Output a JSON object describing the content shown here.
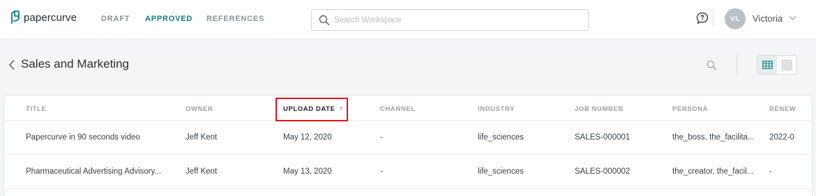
{
  "app": {
    "logo_text": "papercurve"
  },
  "nav": {
    "tabs": [
      {
        "label": "DRAFT"
      },
      {
        "label": "APPROVED"
      },
      {
        "label": "REFERENCES"
      }
    ]
  },
  "search": {
    "placeholder": "Search Workspace"
  },
  "user": {
    "initials": "VL",
    "name": "Victoria"
  },
  "page": {
    "title": "Sales and Marketing"
  },
  "colors": {
    "accent": "#127b7f",
    "highlight": "#e0121a"
  },
  "table": {
    "columns": [
      "TITLE",
      "OWNER",
      "UPLOAD DATE",
      "CHANNEL",
      "INDUSTRY",
      "JOB NUMBER",
      "PERSONA",
      "RENEW"
    ],
    "sort_indicator": "↑",
    "rows": [
      [
        "Papercurve in 90 seconds video",
        "Jeff Kent",
        "May 12, 2020",
        "-",
        "life_sciences",
        "SALES-000001",
        "the_boss, the_facilita...",
        "2022-0"
      ],
      [
        "Pharmaceutical Advertising Advisory...",
        "Jeff Kent",
        "May 13, 2020",
        "-",
        "life_sciences",
        "SALES-000002",
        "the_creator, the_facil...",
        "-"
      ]
    ]
  }
}
